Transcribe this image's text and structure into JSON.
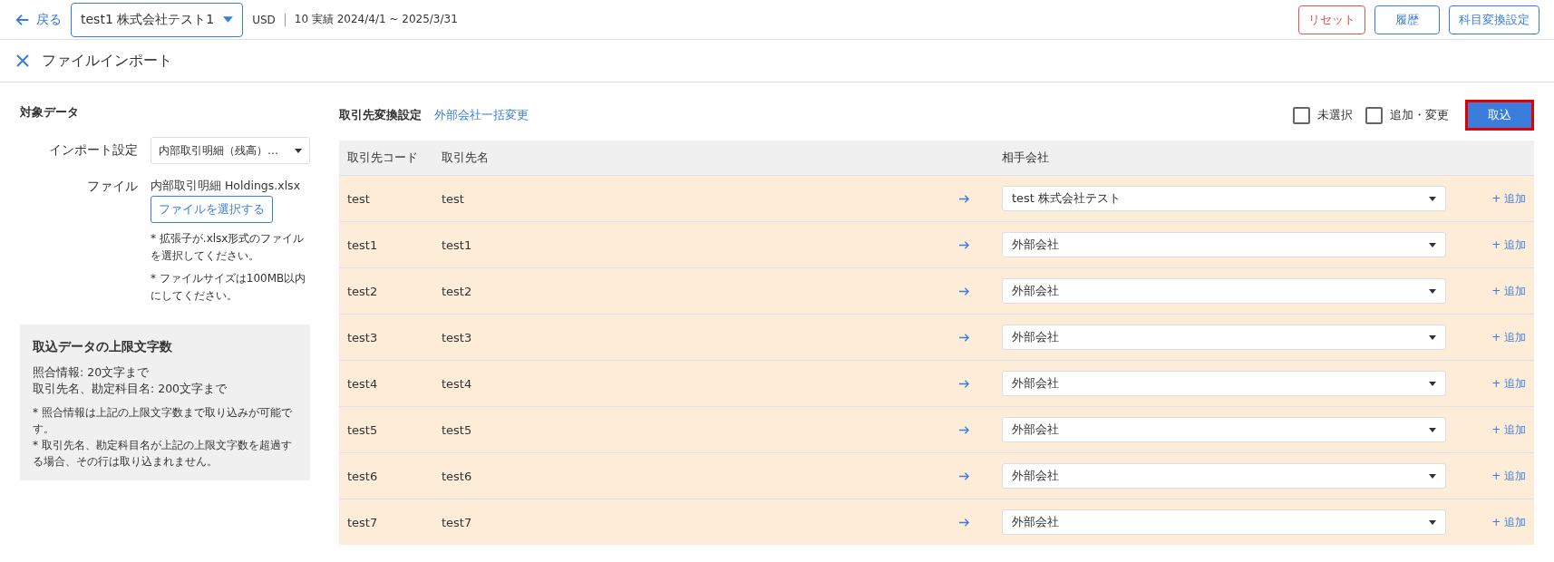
{
  "header": {
    "back": "戻る",
    "company": "test1 株式会社テスト1",
    "currency": "USD",
    "period": "10 実績 2024/4/1 ~ 2025/3/31",
    "buttons": [
      {
        "label": "リセット",
        "kind": "danger"
      },
      {
        "label": "履歴",
        "kind": "outline"
      },
      {
        "label": "科目変換設定",
        "kind": "outline"
      }
    ]
  },
  "page_title": "ファイルインポート",
  "left": {
    "title": "対象データ",
    "import_label": "インポート設定",
    "import_value": "内部取引明細（残高）…",
    "file_label": "ファイル",
    "file_name": "内部取引明細 Holdings.xlsx",
    "file_button": "ファイルを選択する",
    "notes": [
      "* 拡張子が.xlsx形式のファイルを選択してください。",
      "* ファイルサイズは100MB以内にしてください。"
    ],
    "limits": {
      "title": "取込データの上限文字数",
      "lines": [
        "照合情報: 20文字まで",
        "取引先名、勘定科目名: 200文字まで"
      ],
      "notes": [
        "* 照合情報は上記の上限文字数まで取り込みが可能です。",
        "* 取引先名、勘定科目名が上記の上限文字数を超過する場合、その行は取り込まれません。"
      ]
    }
  },
  "right": {
    "title": "取引先変換設定",
    "link": "外部会社一括変更",
    "filters": [
      {
        "label": "未選択",
        "checked": false
      },
      {
        "label": "追加・変更",
        "checked": false
      }
    ],
    "import_button": "取込",
    "table": {
      "columns": [
        "取引先コード",
        "取引先名",
        "相手会社"
      ],
      "rows": [
        {
          "code": "test",
          "name": "test",
          "partner": "test 株式会社テスト",
          "add": "+ 追加"
        },
        {
          "code": "test1",
          "name": "test1",
          "partner": "外部会社",
          "add": "+ 追加"
        },
        {
          "code": "test2",
          "name": "test2",
          "partner": "外部会社",
          "add": "+ 追加"
        },
        {
          "code": "test3",
          "name": "test3",
          "partner": "外部会社",
          "add": "+ 追加"
        },
        {
          "code": "test4",
          "name": "test4",
          "partner": "外部会社",
          "add": "+ 追加"
        },
        {
          "code": "test5",
          "name": "test5",
          "partner": "外部会社",
          "add": "+ 追加"
        },
        {
          "code": "test6",
          "name": "test6",
          "partner": "外部会社",
          "add": "+ 追加"
        },
        {
          "code": "test7",
          "name": "test7",
          "partner": "外部会社",
          "add": "+ 追加"
        }
      ]
    }
  }
}
